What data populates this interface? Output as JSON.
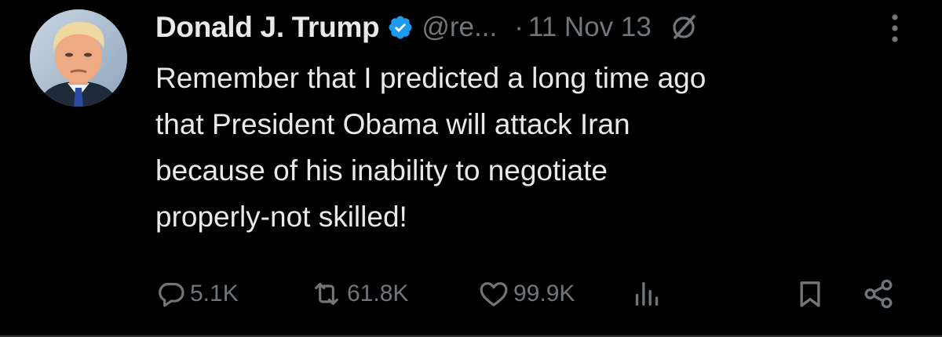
{
  "author": {
    "display_name": "Donald J. Trump",
    "handle": "@re...",
    "verified": true,
    "verified_color": "#1d9bf0"
  },
  "separator": "·",
  "date": "11 Nov 13",
  "tweet": {
    "text": "Remember that I predicted a long time ago\nthat President Obama will attack Iran\nbecause of his inability to negotiate\nproperly-not skilled!"
  },
  "actions": {
    "reply_count": "5.1K",
    "retweet_count": "61.8K",
    "like_count": "99.9K"
  },
  "icons": {
    "reply": "reply-icon",
    "retweet": "retweet-icon",
    "like": "heart-icon",
    "views": "analytics-icon",
    "bookmark": "bookmark-icon",
    "share": "share-icon",
    "grok": "grok-icon",
    "more": "more-icon"
  },
  "colors": {
    "background": "#000000",
    "text": "#e7e9ea",
    "secondary": "#71767b"
  }
}
